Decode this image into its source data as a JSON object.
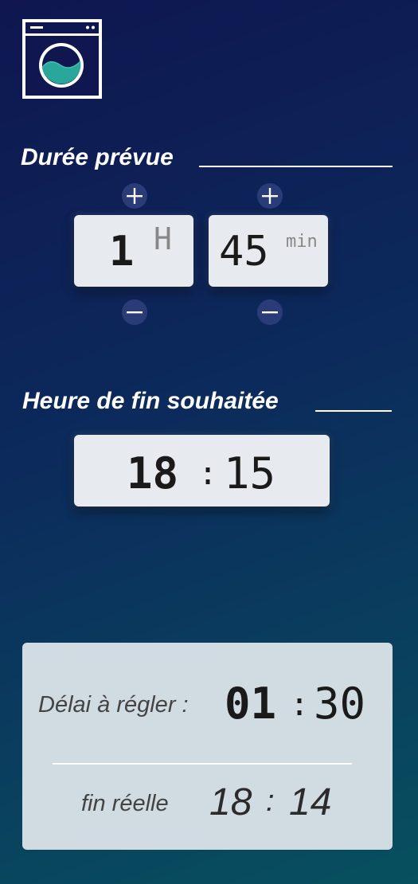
{
  "app": {
    "logo_icon": "washing-machine-icon",
    "accent_color": "#2aa79b"
  },
  "duration": {
    "title": "Durée prévue",
    "hours": {
      "value": "1",
      "unit": "H"
    },
    "minutes": {
      "value": "45",
      "unit": "min"
    },
    "increment_icon": "plus-icon",
    "decrement_icon": "minus-icon"
  },
  "end_time": {
    "title": "Heure de fin souhaitée",
    "hours": "18",
    "separator": ":",
    "minutes": "15"
  },
  "result": {
    "delay_label": "Délai à régler :",
    "delay_hours": "01",
    "delay_separator": ":",
    "delay_minutes": "30",
    "actual_end_label": "fin réelle",
    "actual_end_hours": "18",
    "actual_end_separator": ":",
    "actual_end_minutes": "14"
  }
}
